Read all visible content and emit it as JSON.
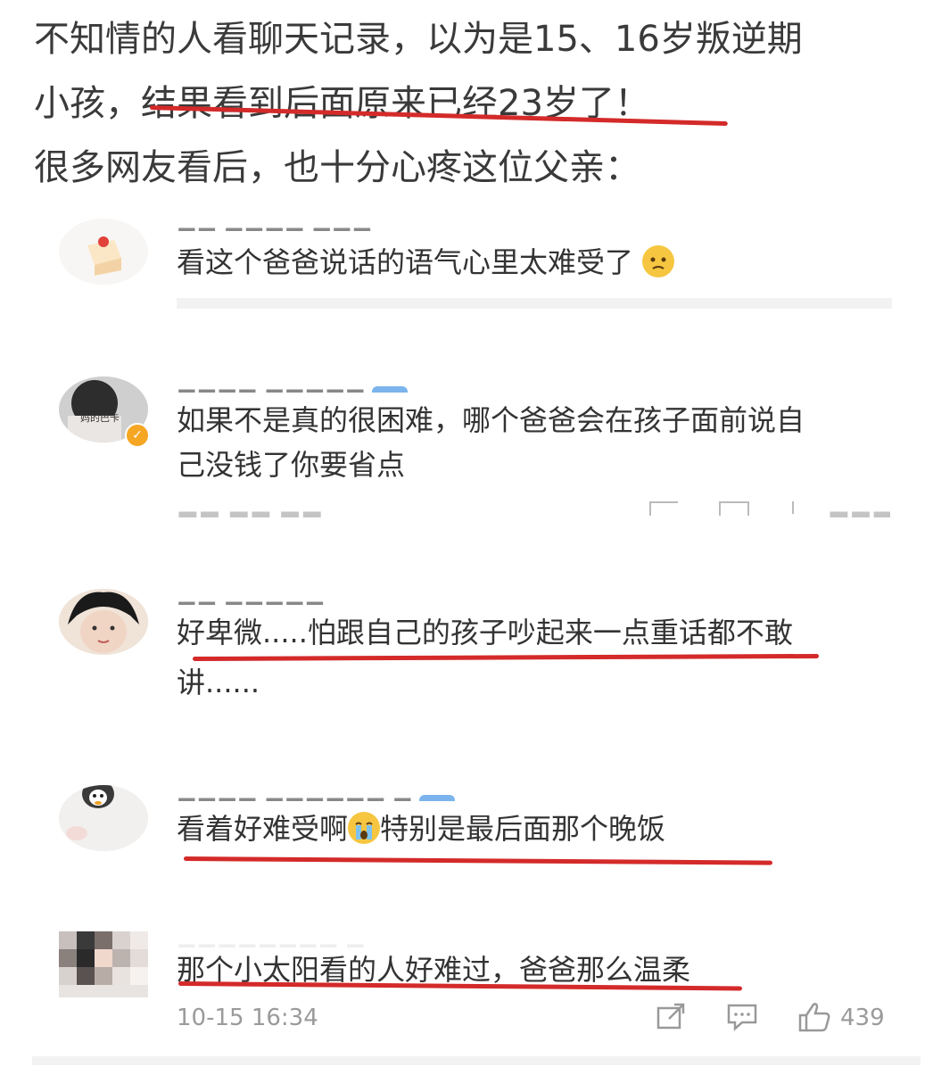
{
  "intro": {
    "line1": "不知情的人看聊天记录，以为是15、16岁叛逆期",
    "line2": "小孩，结果看到后面原来已经23岁了！",
    "line3": "很多网友看后，也十分心疼这位父亲："
  },
  "comments": [
    {
      "text": "看这个爸爸说话的语气心里太难受了",
      "emoji": "sad-face-emoji"
    },
    {
      "text_line1": "如果不是真的很困难，哪个爸爸会在孩子面前说自",
      "text_line2": "己没钱了你要省点",
      "avatar_label": "妈的巴卡"
    },
    {
      "text_line1": "好卑微.....怕跟自己的孩子吵起来一点重话都不敢",
      "text_line2": "讲......"
    },
    {
      "text_before": "看着好难受啊",
      "emoji": "crying-face-emoji",
      "text_after": "特别是最后面那个晚饭"
    },
    {
      "text": "那个小太阳看的人好难过，爸爸那么温柔",
      "timestamp": "10-15 16:34",
      "likes": "439"
    }
  ],
  "colors": {
    "underline": "#d42a2a",
    "verified_badge": "#f5a623",
    "vip_tag": "#7bb4ec"
  }
}
